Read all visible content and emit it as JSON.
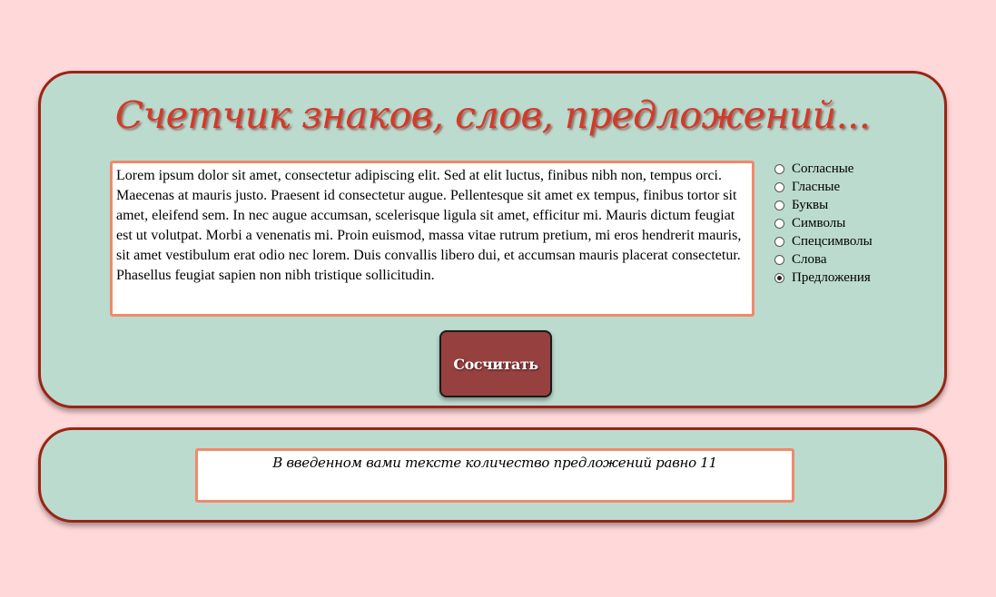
{
  "header": {
    "title": "Счетчик знаков, слов, предложений..."
  },
  "input": {
    "text": "Lorem ipsum dolor sit amet, consectetur adipiscing elit. Sed at elit luctus, finibus nibh non, tempus orci. Maecenas at mauris justo. Praesent id consectetur augue. Pellentesque sit amet ex tempus, finibus tortor sit amet, eleifend sem. In nec augue accumsan, scelerisque ligula sit amet, efficitur mi. Mauris dictum feugiat est ut volutpat. Morbi a venenatis mi. Proin euismod, massa vitae rutrum pretium, mi eros hendrerit mauris, sit amet vestibulum erat odio nec lorem. Duis convallis libero dui, et accumsan mauris placerat consectetur. Phasellus feugiat sapien non nibh tristique sollicitudin."
  },
  "options": [
    {
      "label": "Согласные",
      "checked": false
    },
    {
      "label": "Гласные",
      "checked": false
    },
    {
      "label": "Буквы",
      "checked": false
    },
    {
      "label": "Символы",
      "checked": false
    },
    {
      "label": "Спецсимволы",
      "checked": false
    },
    {
      "label": "Слова",
      "checked": false
    },
    {
      "label": "Предложения",
      "checked": true
    }
  ],
  "button": {
    "label": "Сосчитать"
  },
  "result": {
    "text": "В введенном вами тексте количество предложений равно 11"
  },
  "colors": {
    "background": "#ffd9d9",
    "panel": "#bbdbcf",
    "panel_border": "#9b2414",
    "title": "#d23a2a",
    "field_border": "#f08a6a",
    "button": "#974040"
  }
}
